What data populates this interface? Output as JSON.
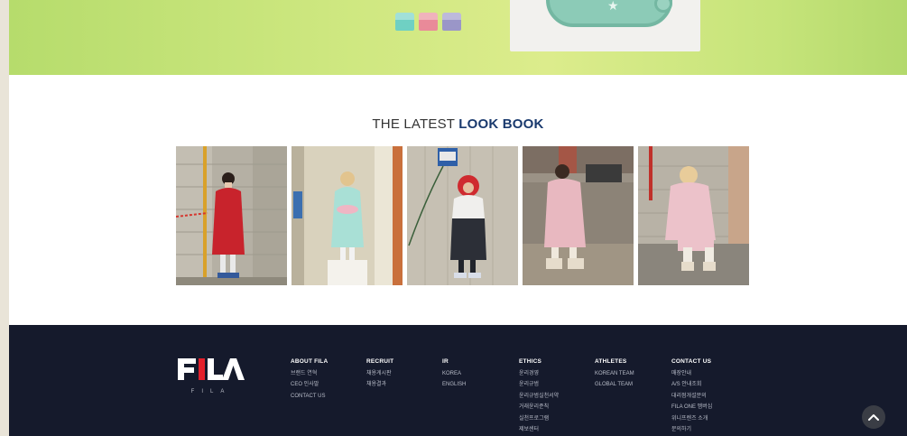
{
  "colors": {
    "outer_bg": "#e9e4d8",
    "promo_green": "#cde77f",
    "lookbook_accent": "#1a3a6e",
    "footer_bg": "#151a2c",
    "fila_red": "#e2202b"
  },
  "promo": {
    "swatches": [
      "#6fd0c3",
      "#e98a99",
      "#9a96c8"
    ],
    "star_icon": "★"
  },
  "lookbook": {
    "title_light": "THE LATEST",
    "title_bold": "LOOK BOOK",
    "photos": [
      {
        "name": "lookbook-photo-1",
        "coat_color": "#c8232c"
      },
      {
        "name": "lookbook-photo-2",
        "coat_color": "#a9e0d6"
      },
      {
        "name": "lookbook-photo-3",
        "coat_color": "#2c2f37"
      },
      {
        "name": "lookbook-photo-4",
        "coat_color": "#e8b8c0"
      },
      {
        "name": "lookbook-photo-5",
        "coat_color": "#ecc2ca"
      }
    ]
  },
  "footer": {
    "logo_sub": "FILA",
    "columns": [
      {
        "head": "ABOUT FILA",
        "links": [
          "브랜드 연혁",
          "CEO 인사말",
          "CONTACT US"
        ]
      },
      {
        "head": "RECRUIT",
        "links": [
          "채용게시판",
          "채용결과"
        ]
      },
      {
        "head": "IR",
        "links": [
          "KOREA",
          "ENGLISH"
        ]
      },
      {
        "head": "ETHICS",
        "links": [
          "윤리경영",
          "윤리규범",
          "윤리규범실천서약",
          "거래윤리준칙",
          "실천프로그램",
          "제보센터"
        ]
      },
      {
        "head": "ATHLETES",
        "links": [
          "KOREAN TEAM",
          "GLOBAL TEAM"
        ]
      },
      {
        "head": "CONTACT US",
        "links": [
          "매장안내",
          "A/S 안내조회",
          "대리점개설문의",
          "FILA ONE 멤버십",
          "위니프렌즈 소개",
          "문의하기"
        ]
      }
    ]
  },
  "scroll_top_icon": "chevron-up"
}
